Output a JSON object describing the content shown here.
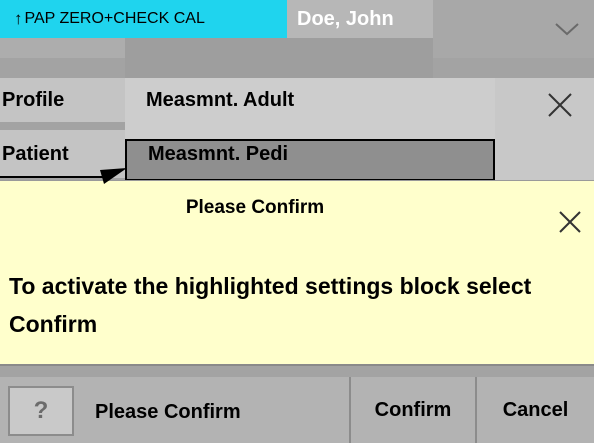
{
  "status_bar": {
    "alarm_arrow": "↑",
    "alarm_text": "PAP ZERO+CHECK CAL",
    "patient_name": "Doe, John",
    "alarm_color": "#1fd4ee"
  },
  "profile_dialog": {
    "profile_label": "Profile",
    "patient_label": "Patient",
    "items": [
      {
        "label": "Measmnt. Adult",
        "highlighted": false
      },
      {
        "label": "Measmnt. Pedi",
        "highlighted": true
      }
    ]
  },
  "confirm_dialog": {
    "title": "Please Confirm",
    "message": "To activate the highlighted settings block select Confirm",
    "background_color": "#ffffcc"
  },
  "bottom_bar": {
    "help_label": "?",
    "title": "Please Confirm",
    "confirm_label": "Confirm",
    "cancel_label": "Cancel"
  },
  "icons": {
    "close": "close-icon",
    "chevron": "chevron-down-icon",
    "arrow": "leader-arrow"
  }
}
